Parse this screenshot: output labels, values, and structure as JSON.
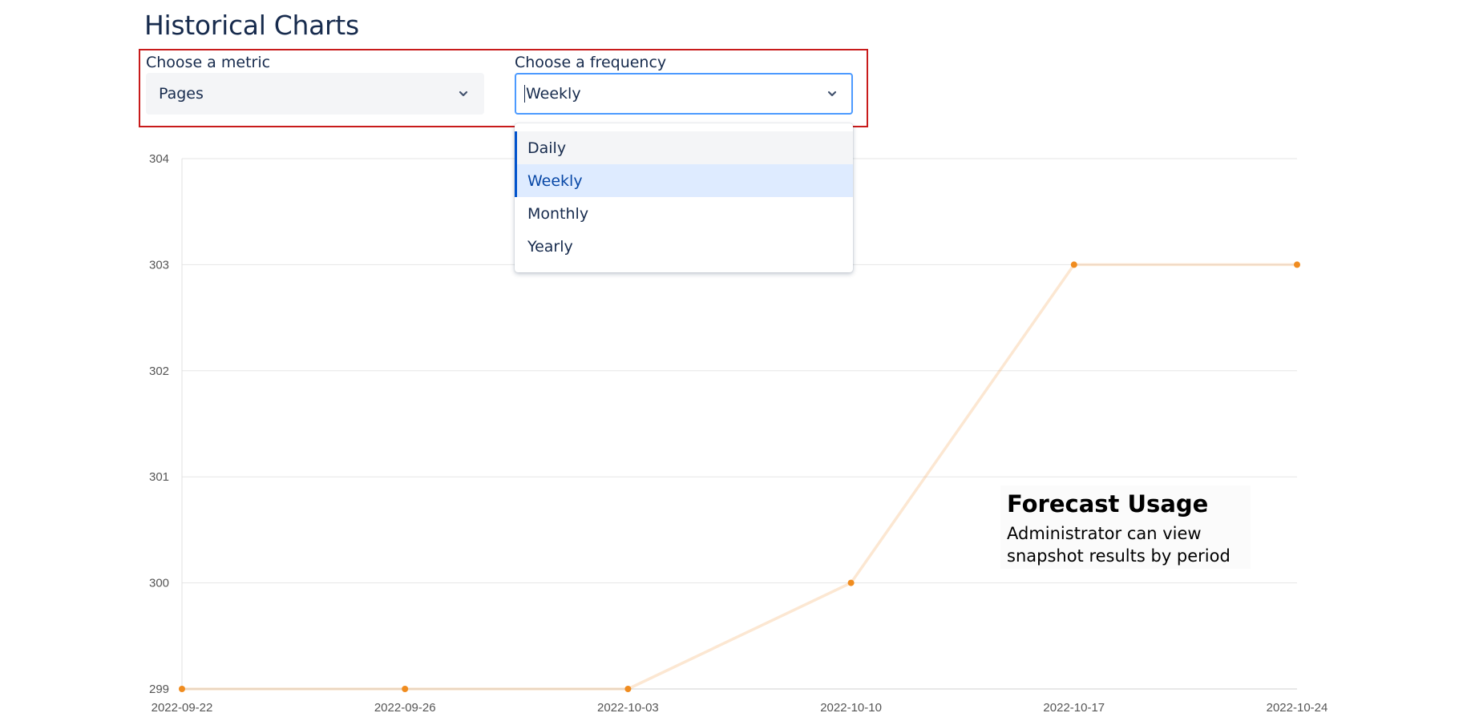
{
  "header": {
    "title": "Historical Charts"
  },
  "metric": {
    "label": "Choose a metric",
    "value": "Pages"
  },
  "frequency": {
    "label": "Choose a frequency",
    "value": "Weekly",
    "options": [
      "Daily",
      "Weekly",
      "Monthly",
      "Yearly"
    ]
  },
  "callout": {
    "title": "Forecast Usage",
    "line1": "Administrator can view",
    "line2": "snapshot results by period"
  },
  "colors": {
    "series": "#f5a04a",
    "marker": "#f08c1f",
    "accent": "#0052cc",
    "frame": "#c81b1b",
    "focus": "#4c9aff"
  },
  "chart_data": {
    "type": "line",
    "x": [
      "2022-09-22",
      "2022-09-26",
      "2022-10-03",
      "2022-10-10",
      "2022-10-17",
      "2022-10-24"
    ],
    "series": [
      {
        "values": [
          299,
          299,
          299,
          300,
          303,
          303
        ]
      }
    ],
    "ylim": [
      299,
      304
    ],
    "yticks": [
      299,
      300,
      301,
      302,
      303,
      304
    ],
    "grid": true
  }
}
